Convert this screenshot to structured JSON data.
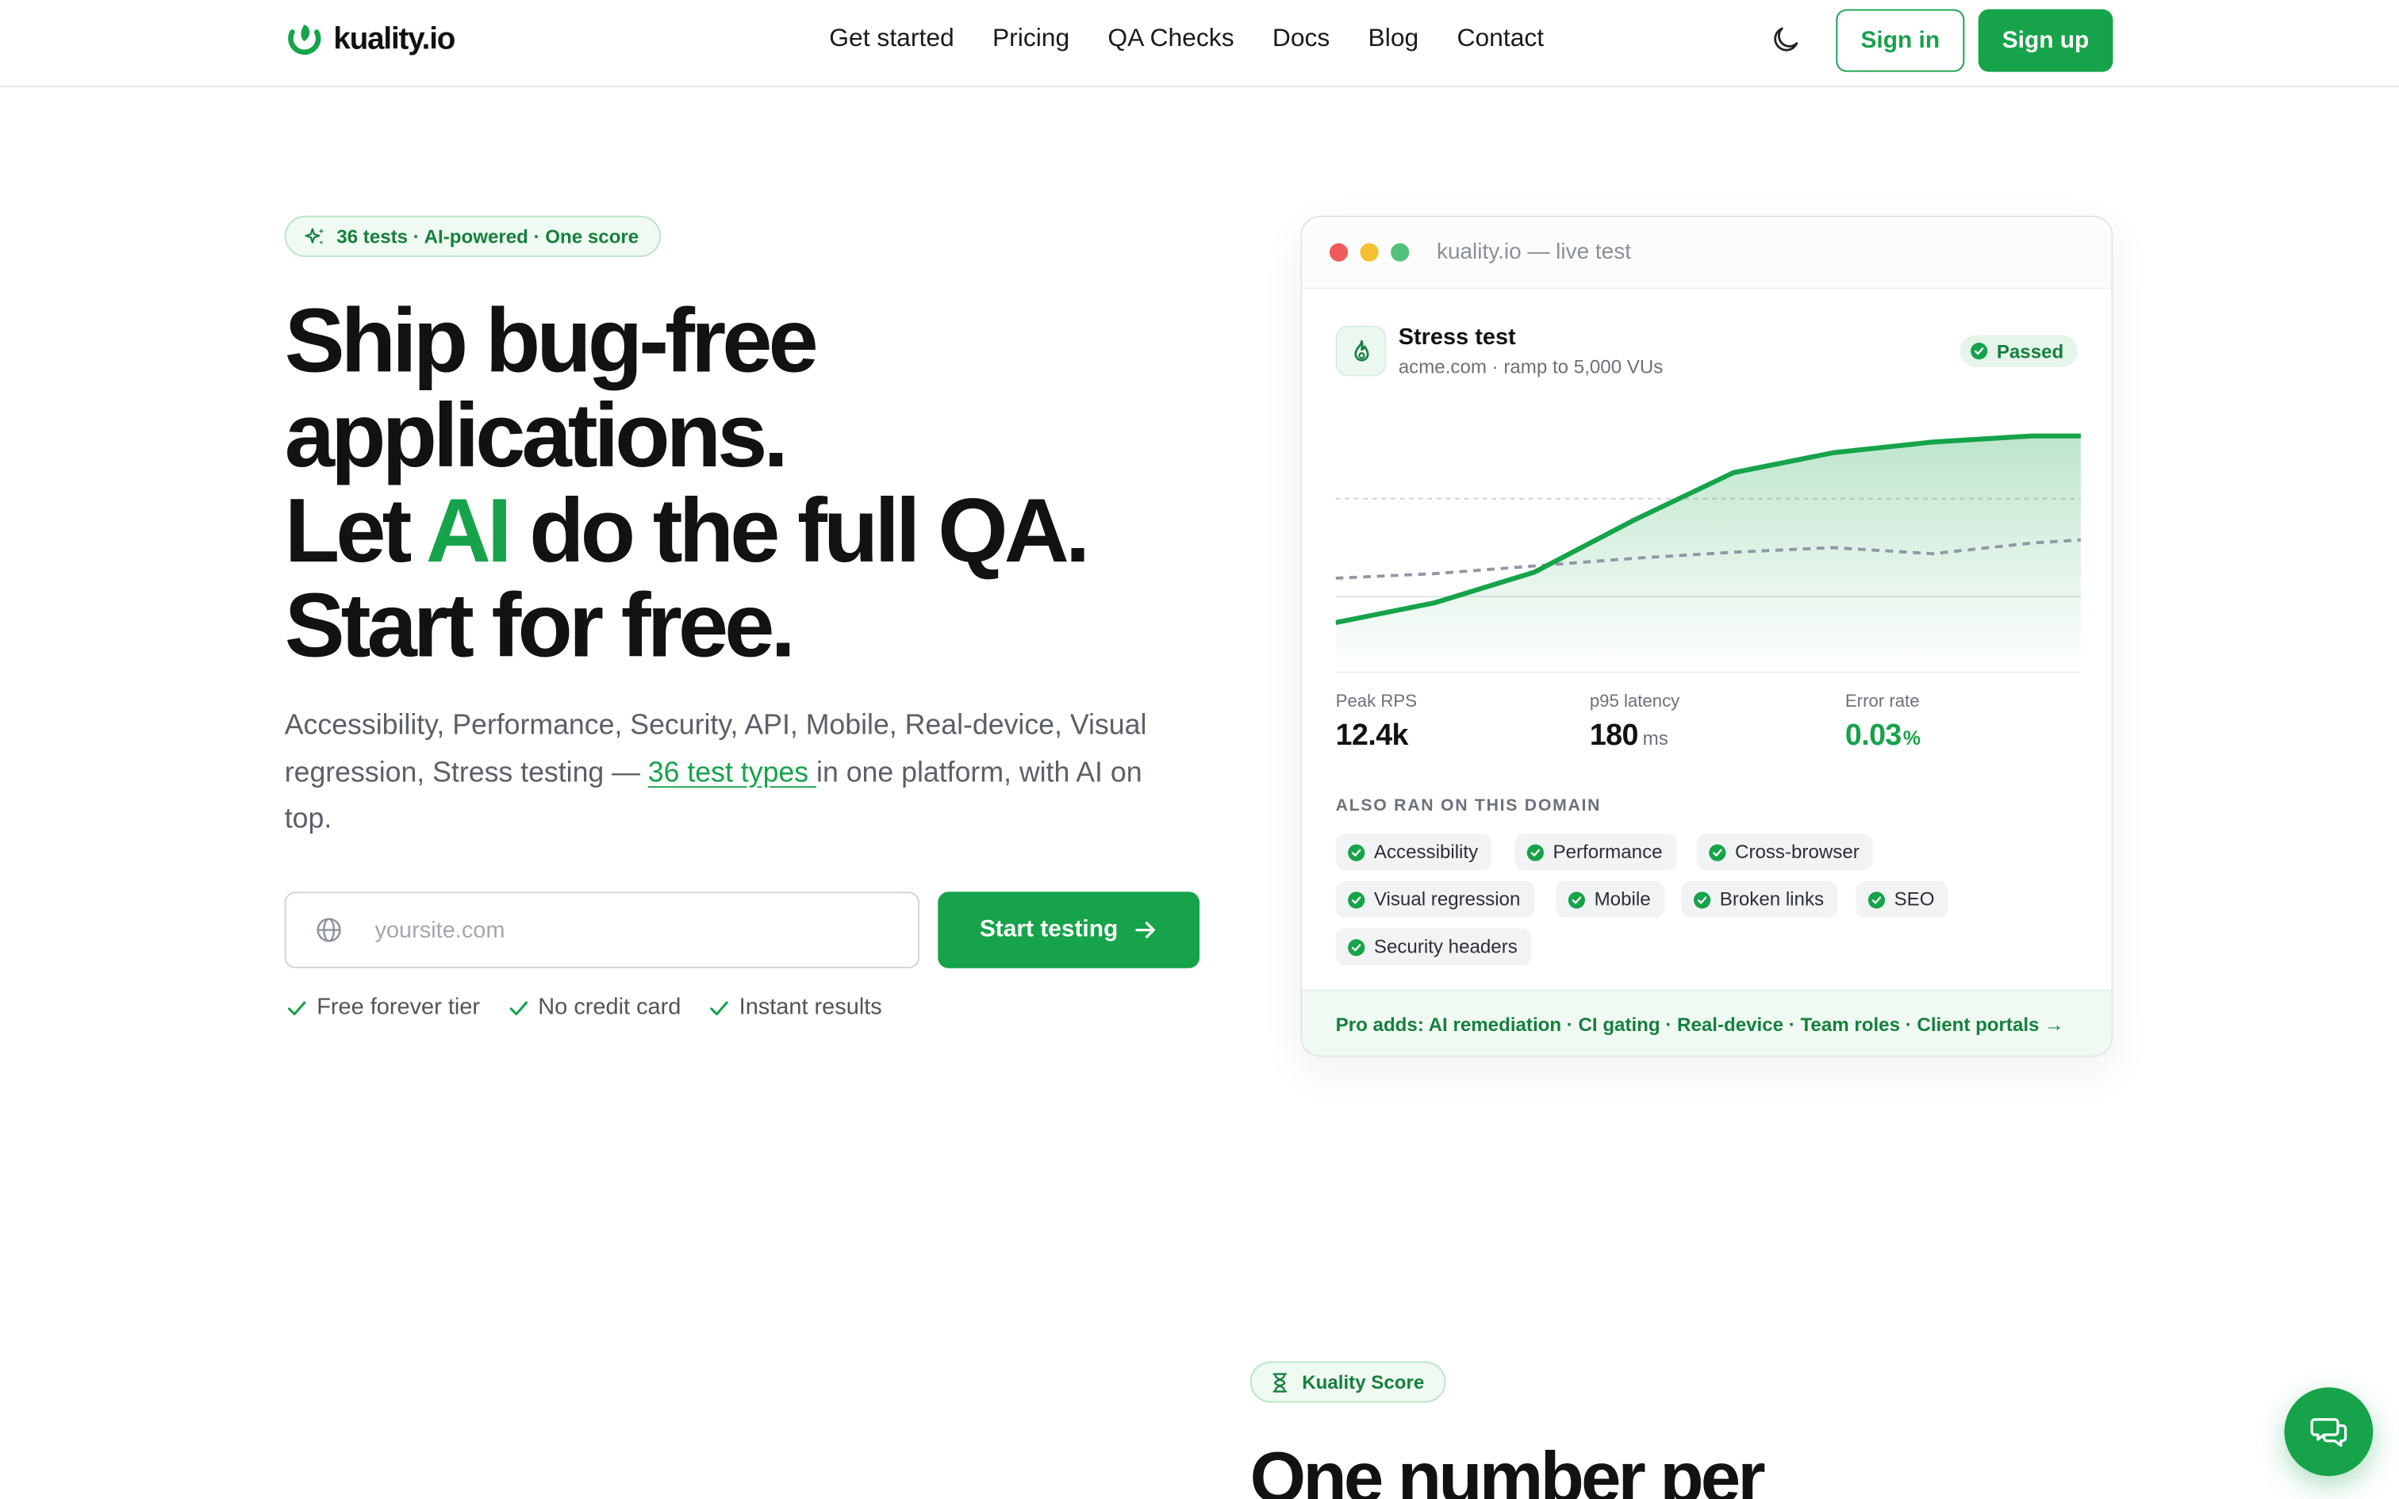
{
  "brand": {
    "name": "kuality.io",
    "accent": "#16a34a"
  },
  "nav": {
    "items": [
      {
        "label": "Get started"
      },
      {
        "label": "Pricing"
      },
      {
        "label": "QA Checks"
      },
      {
        "label": "Docs"
      },
      {
        "label": "Blog"
      },
      {
        "label": "Contact"
      }
    ],
    "theme_icon": "moon-icon",
    "signin_label": "Sign in",
    "signup_label": "Sign up"
  },
  "hero": {
    "pill": "36 tests · AI-powered · One score",
    "headline": {
      "line1": "Ship bug-free",
      "line2": "applications.",
      "line3_pre": "Let ",
      "line3_ai": "AI",
      "line3_post": " do the full QA.",
      "line4": "Start for free."
    },
    "sub": {
      "pre": "Accessibility, Performance, Security, API, Mobile, Real-device, Visual regression, Stress testing — ",
      "link": "36 test types ",
      "post": "in one platform, with AI on top."
    },
    "input_placeholder": "yoursite.com",
    "input_value": "",
    "cta_label": "Start testing",
    "checks": [
      "Free forever tier",
      "No credit card",
      "Instant results"
    ]
  },
  "card": {
    "window_title": "kuality.io — live test",
    "test_title": "Stress test",
    "test_sub": "acme.com · ramp to 5,000 VUs",
    "status": "Passed",
    "metrics": [
      {
        "label": "Peak RPS",
        "value": "12.4k",
        "unit": ""
      },
      {
        "label": "p95 latency",
        "value": "180",
        "unit": "ms"
      },
      {
        "label": "Error rate",
        "value": "0.03",
        "unit": "%"
      }
    ],
    "also_label": "ALSO RAN ON THIS DOMAIN",
    "tags": [
      "Accessibility",
      "Performance",
      "Cross-browser",
      "Visual regression",
      "Mobile",
      "Broken links",
      "SEO",
      "Security headers"
    ],
    "footer": "Pro adds: AI remediation · CI gating · Real-device · Team roles · Client portals →"
  },
  "section2": {
    "pill": "Kuality Score",
    "title": "One number per"
  },
  "chat": {
    "icon": "chat-icon"
  }
}
